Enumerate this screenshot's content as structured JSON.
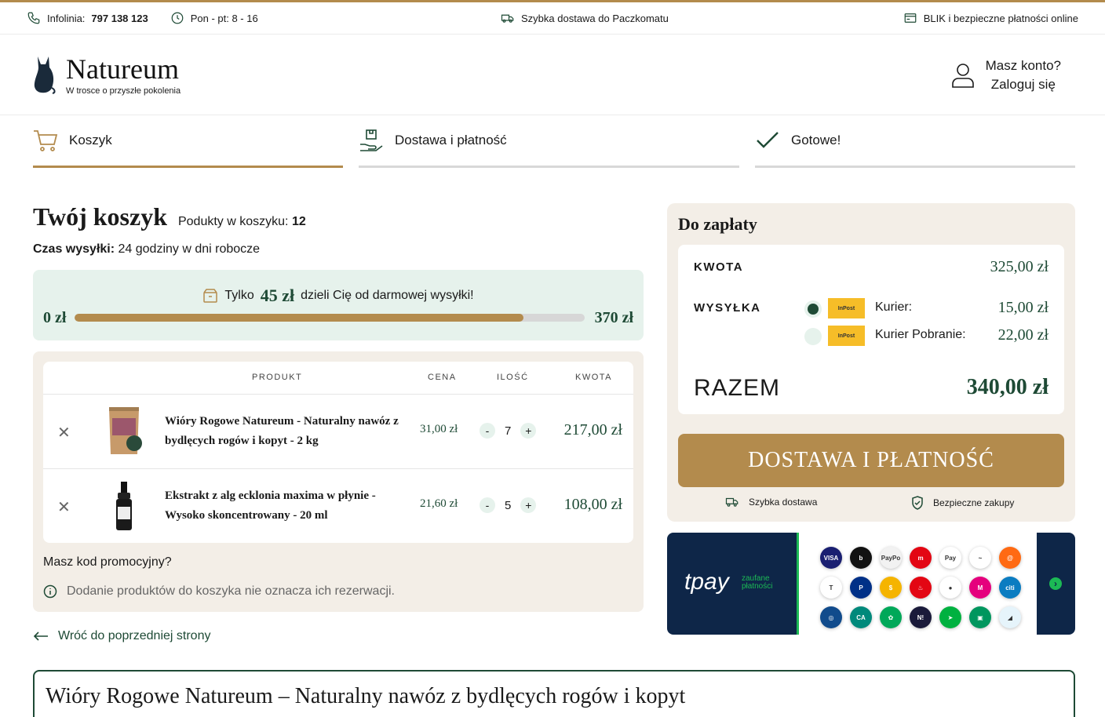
{
  "topbar": {
    "infolinia_label": "Infolinia:",
    "phone": "797 138 123",
    "hours": "Pon - pt: 8 - 16",
    "delivery": "Szybka dostawa do Paczkomatu",
    "payments": "BLIK i bezpieczne płatności online"
  },
  "header": {
    "brand": "Natureum",
    "tagline": "W trosce o przyszłe pokolenia",
    "account_line1": "Masz konto?",
    "account_line2": "Zaloguj się"
  },
  "steps": [
    {
      "label": "Koszyk",
      "active": true
    },
    {
      "label": "Dostawa i płatność",
      "active": false
    },
    {
      "label": "Gotowe!",
      "active": false
    }
  ],
  "cart": {
    "title": "Twój koszyk",
    "count_label": "Podukty w koszyku:",
    "count": "12",
    "ship_label": "Czas wysyłki:",
    "ship_value": "24 godziny w dni robocze",
    "free_prefix": "Tylko",
    "free_amount": "45 zł",
    "free_suffix": "dzieli Cię od darmowej wysyłki!",
    "free_min": "0 zł",
    "free_max": "370 zł",
    "free_progress_fraction": 0.88,
    "columns": {
      "product": "PRODUKT",
      "price": "CENA",
      "qty": "ILOŚĆ",
      "total": "KWOTA"
    },
    "items": [
      {
        "name": "Wióry Rogowe Natureum - Naturalny nawóz z bydlęcych rogów i kopyt - 2 kg",
        "price": "31,00 zł",
        "qty": "7",
        "total": "217,00 zł"
      },
      {
        "name": "Ekstrakt z alg ecklonia maxima w płynie - Wysoko skoncentrowany - 20 ml",
        "price": "21,60 zł",
        "qty": "5",
        "total": "108,00 zł"
      }
    ],
    "promo": "Masz kod promocyjny?",
    "note": "Dodanie produktów do koszyka nie oznacza ich rezerwacji.",
    "back": "Wróć do poprzedniej strony"
  },
  "summary": {
    "title": "Do zapłaty",
    "kwota_label": "KWOTA",
    "kwota": "325,00 zł",
    "wysylka_label": "WYSYŁKA",
    "options": [
      {
        "label": "Kurier:",
        "price": "15,00 zł",
        "selected": true
      },
      {
        "label": "Kurier Pobranie:",
        "price": "22,00 zł",
        "selected": false
      }
    ],
    "inpost_text": "InPost",
    "razem_label": "RAZEM",
    "razem": "340,00 zł",
    "cta": "DOSTAWA I PŁATNOŚĆ",
    "feature1": "Szybka dostawa",
    "feature2": "Bezpieczne zakupy"
  },
  "tpay": {
    "brand": "tpay",
    "sub1": "zaufane",
    "sub2": "płatności",
    "logos": [
      {
        "t": "VISA",
        "c": "#1a1f71"
      },
      {
        "t": "b",
        "c": "#111"
      },
      {
        "t": "PayPo",
        "c": "#f2f2f2"
      },
      {
        "t": "m",
        "c": "#e30613"
      },
      {
        "t": "Pay",
        "c": "#fff"
      },
      {
        "t": "~",
        "c": "#fff"
      },
      {
        "t": "@",
        "c": "#ff6a13"
      },
      {
        "t": "T",
        "c": "#fff"
      },
      {
        "t": "P",
        "c": "#003087"
      },
      {
        "t": "$",
        "c": "#f5b400"
      },
      {
        "t": "♨",
        "c": "#e30613"
      },
      {
        "t": "●",
        "c": "#fff"
      },
      {
        "t": "M",
        "c": "#e5007d"
      },
      {
        "t": "citi",
        "c": "#0b7cc1"
      },
      {
        "t": "◎",
        "c": "#114b8c"
      },
      {
        "t": "CA",
        "c": "#00897b"
      },
      {
        "t": "✿",
        "c": "#00a859"
      },
      {
        "t": "N!",
        "c": "#1a1a3a"
      },
      {
        "t": "➤",
        "c": "#00b140"
      },
      {
        "t": "▣",
        "c": "#00965e"
      },
      {
        "t": "◢",
        "c": "#e6f4fb"
      }
    ]
  },
  "bottom_title": "Wióry Rogowe Natureum – Naturalny nawóz z bydlęcych rogów i kopyt",
  "colors": {
    "accent": "#b38b4d",
    "green": "#1e4a35",
    "mint": "#e6f2ec",
    "beige": "#f3eee7"
  }
}
